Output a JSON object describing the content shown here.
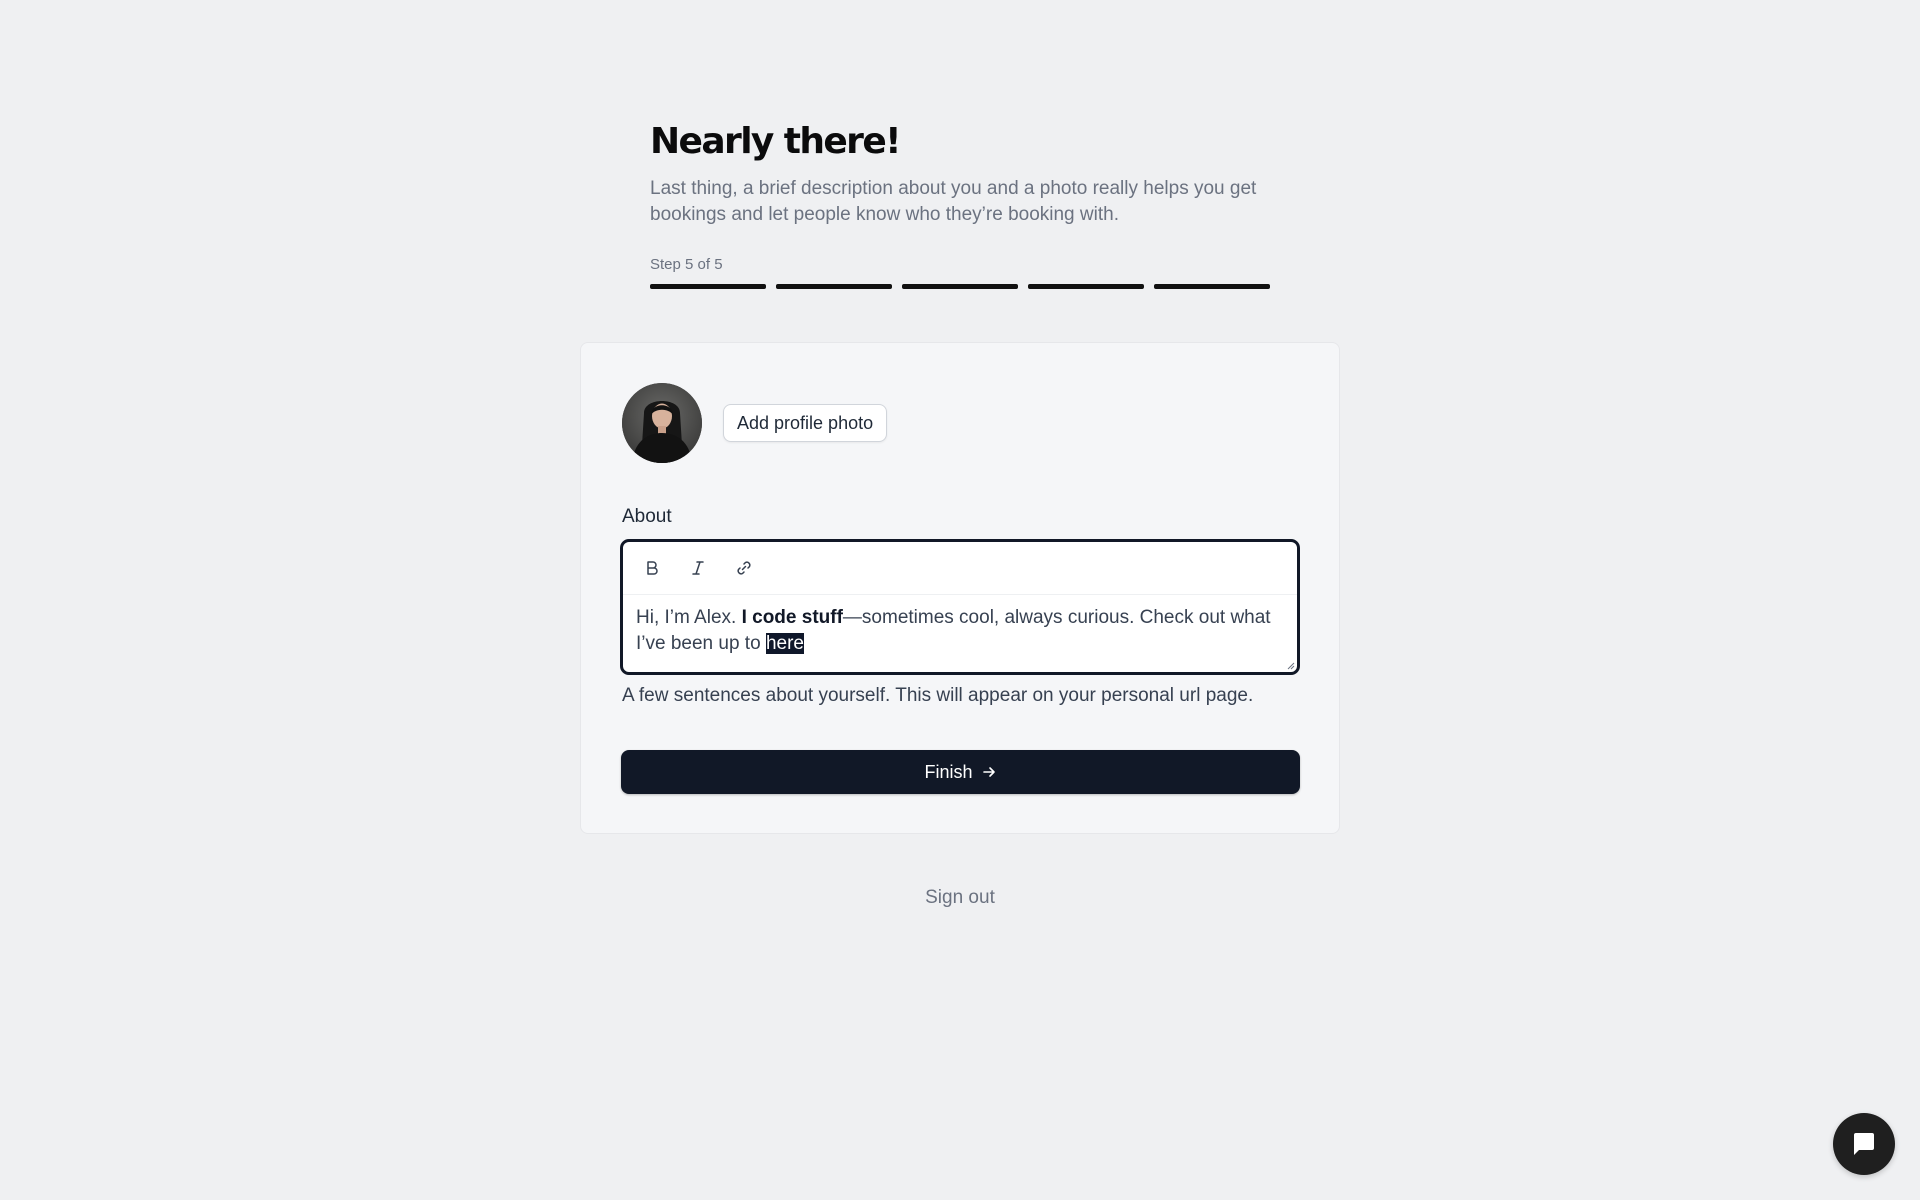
{
  "header": {
    "title": "Nearly there!",
    "subtitle": "Last thing, a brief description about you and a photo really helps you get bookings and let people know who they’re booking with.",
    "step_label": "Step 5 of 5",
    "progress": {
      "current_step": 5,
      "total_steps": 5
    }
  },
  "profile": {
    "avatar_alt": "profile photo",
    "add_photo_label": "Add profile photo"
  },
  "about": {
    "label": "About",
    "toolbar": [
      "bold-icon",
      "italic-icon",
      "link-icon"
    ],
    "text_before": "Hi, I’m Alex. ",
    "text_bold": "I code stuff",
    "text_after": "—sometimes cool, always curious. Check out what I’ve been up to ",
    "text_selected": "here",
    "helper": "A few sentences about yourself. This will appear on your personal url page."
  },
  "actions": {
    "finish_label": "Finish",
    "signout_label": "Sign out"
  },
  "chat": {
    "icon": "chat-bubble-icon"
  },
  "colors": {
    "background": "#eff0f2",
    "card": "#f5f6f8",
    "primary": "#111827",
    "progress": "#111111",
    "muted_text": "#6b7280"
  }
}
